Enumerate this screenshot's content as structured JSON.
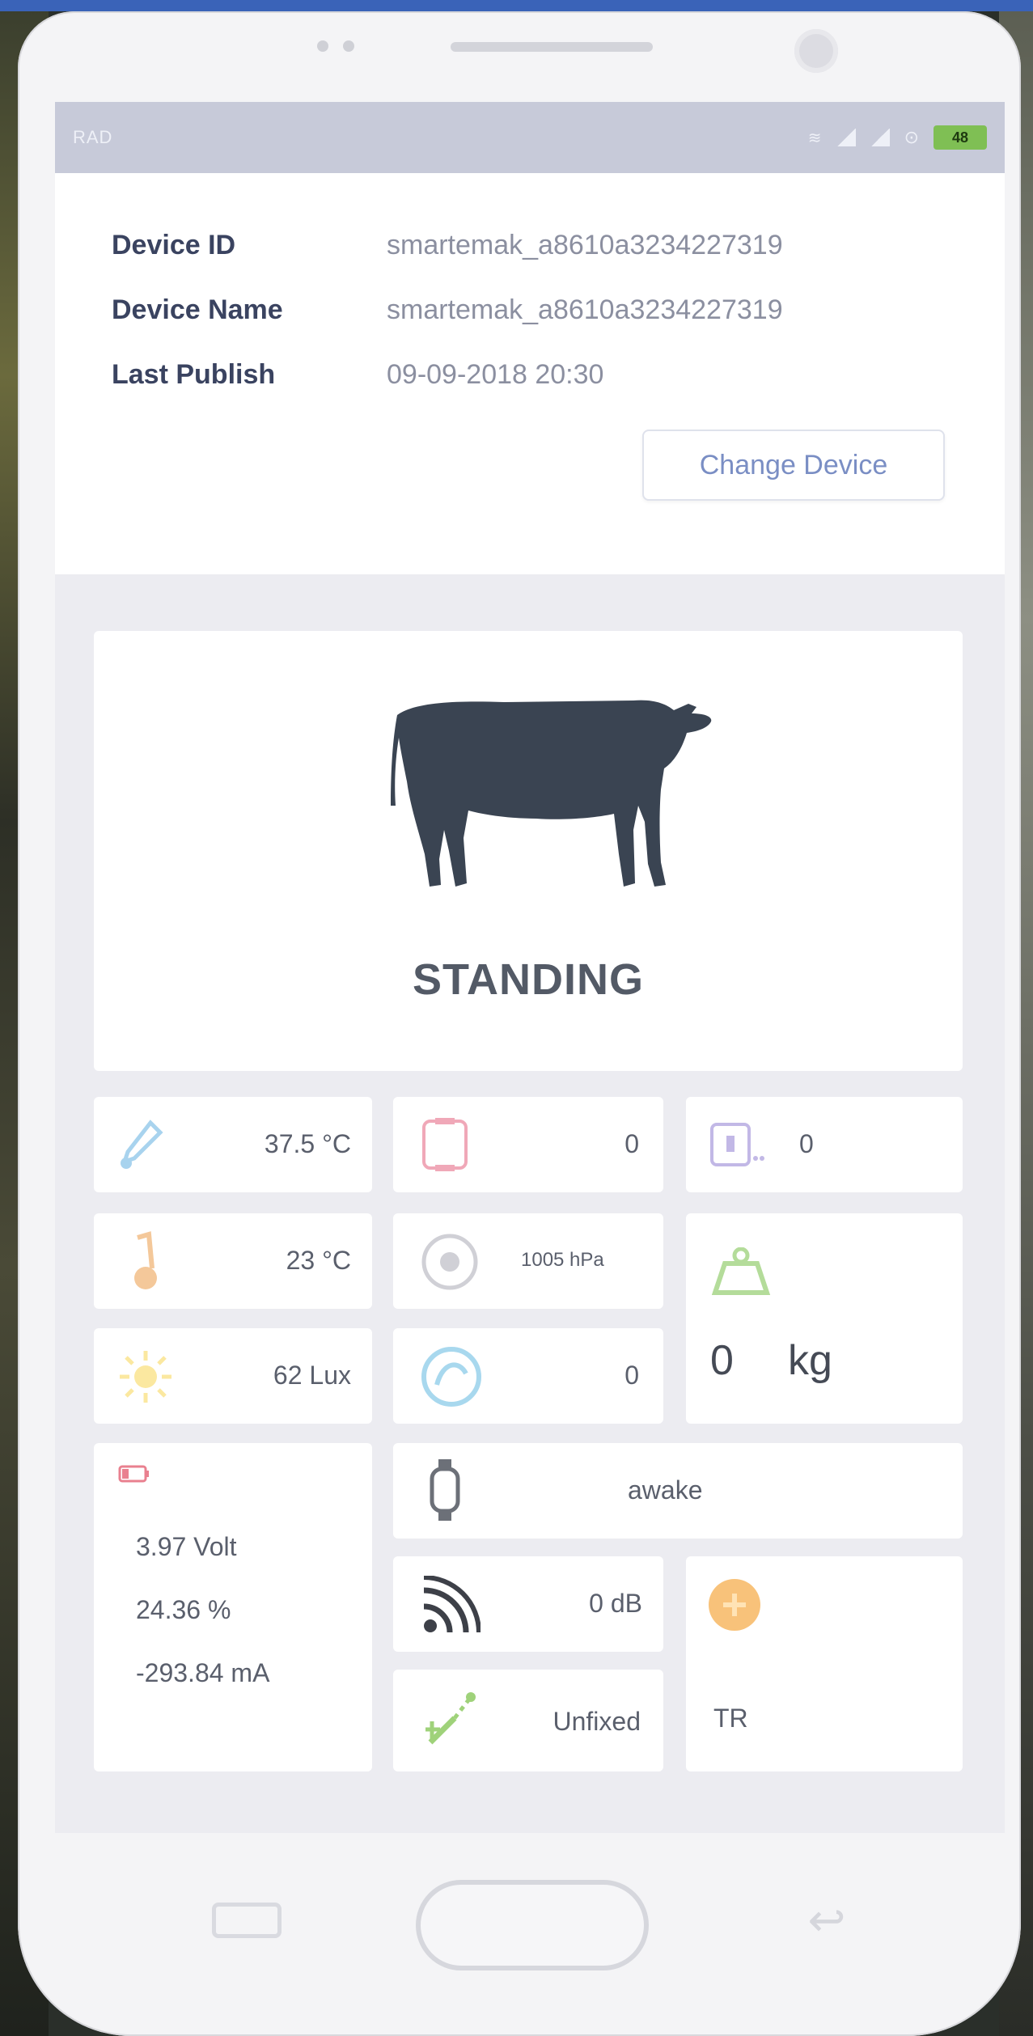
{
  "status_bar": {
    "left_text": "RAD",
    "battery": "48"
  },
  "device_info": {
    "rows": [
      {
        "label": "Device ID",
        "value": "smartemak_a8610a3234227319"
      },
      {
        "label": "Device Name",
        "value": "smartemak_a8610a3234227319"
      },
      {
        "label": "Last Publish",
        "value": "09-09-2018 20:30"
      }
    ],
    "change_button": "Change Device"
  },
  "cow_state": {
    "label": "STANDING"
  },
  "sensors": {
    "body_temp": "37.5 °C",
    "alert_count": "0",
    "steps": "0",
    "ambient_temp": "23 °C",
    "ambient_other": "1005 hPa",
    "weight_value": "0",
    "weight_unit": "kg",
    "light": "62 Lux",
    "rumination": "0",
    "activity": "awake",
    "battery_voltage": "3.97 Volt",
    "battery_percent": "24.36 %",
    "battery_current": "-293.84 mA",
    "signal": "0 dB",
    "gps": "Unfixed",
    "heat": "TR"
  },
  "colors": {
    "status_bar": "#c7cad9",
    "cow": "#3a4452",
    "button_text": "#7a8ec4"
  }
}
